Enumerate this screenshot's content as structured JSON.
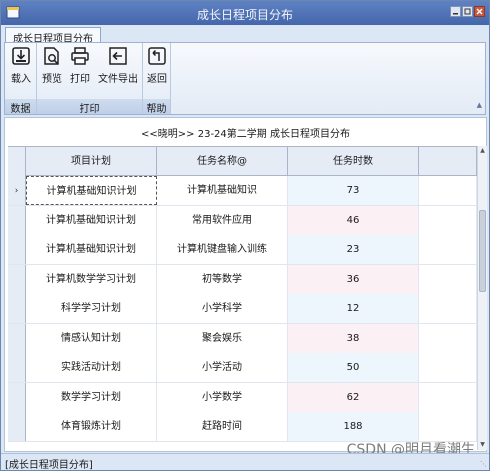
{
  "window": {
    "title": "成长日程项目分布"
  },
  "ribbon": {
    "tab_label": "成长日程项目分布",
    "groups": [
      {
        "label": "数据",
        "buttons": [
          {
            "label": "载入",
            "icon": "load-icon"
          }
        ]
      },
      {
        "label": "打印",
        "buttons": [
          {
            "label": "预览",
            "icon": "preview-icon"
          },
          {
            "label": "打印",
            "icon": "printer-icon"
          },
          {
            "label": "文件导出",
            "icon": "export-icon"
          }
        ]
      },
      {
        "label": "帮助",
        "buttons": [
          {
            "label": "返回",
            "icon": "return-icon"
          }
        ]
      }
    ]
  },
  "content": {
    "caption": "<<晓明>> 23-24第二学期 成长日程项目分布",
    "columns": [
      "项目计划",
      "任务名称@",
      "任务时数"
    ],
    "rows": [
      {
        "plan": "计算机基础知识计划",
        "task": "计算机基础知识",
        "hours": "73"
      },
      {
        "plan": "计算机基础知识计划",
        "task": "常用软件应用",
        "hours": "46"
      },
      {
        "plan": "计算机基础知识计划",
        "task": "计算机键盘输入训练",
        "hours": "23"
      },
      {
        "plan": "计算机数学学习计划",
        "task": "初等数学",
        "hours": "36"
      },
      {
        "plan": "科学学习计划",
        "task": "小学科学",
        "hours": "12"
      },
      {
        "plan": "情感认知计划",
        "task": "聚会娱乐",
        "hours": "38"
      },
      {
        "plan": "实践活动计划",
        "task": "小学活动",
        "hours": "50"
      },
      {
        "plan": "数学学习计划",
        "task": "小学数学",
        "hours": "62"
      },
      {
        "plan": "体育锻炼计划",
        "task": "赶路时间",
        "hours": "188"
      }
    ]
  },
  "statusbar": {
    "text": "[成长日程项目分布]"
  },
  "watermark": "CSDN @明月看潮生",
  "colors": {
    "titlebar": "#4f72b8",
    "ribbon_bg": "#dce7f5",
    "row_alt_blue": "#edf5fd",
    "row_alt_pink": "#fbf1f4"
  }
}
